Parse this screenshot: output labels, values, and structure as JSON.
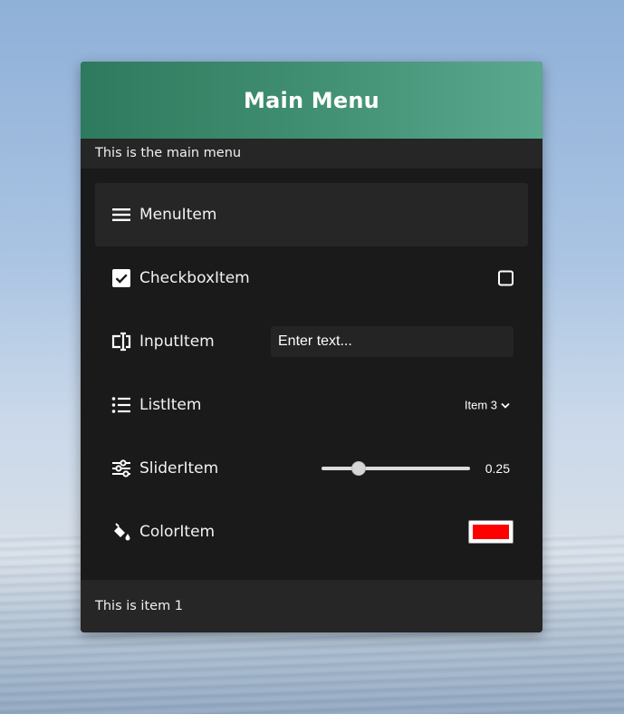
{
  "menu": {
    "title": "Main Menu",
    "subtitle": "This is the main menu",
    "footer_text": "This is item 1",
    "accent_color": "#2e7a5e",
    "items": [
      {
        "label": "MenuItem",
        "icon": "hamburger-icon",
        "active": true
      },
      {
        "label": "CheckboxItem",
        "icon": "checked-box-icon",
        "checked": false
      },
      {
        "label": "InputItem",
        "icon": "text-cursor-input-icon",
        "placeholder": "Enter text..."
      },
      {
        "label": "ListItem",
        "icon": "list-icon",
        "selected": "Item 3"
      },
      {
        "label": "SliderItem",
        "icon": "sliders-icon",
        "value": 0.25,
        "value_text": "0.25"
      },
      {
        "label": "ColorItem",
        "icon": "paint-bucket-icon",
        "color": "#ff0000"
      }
    ]
  }
}
